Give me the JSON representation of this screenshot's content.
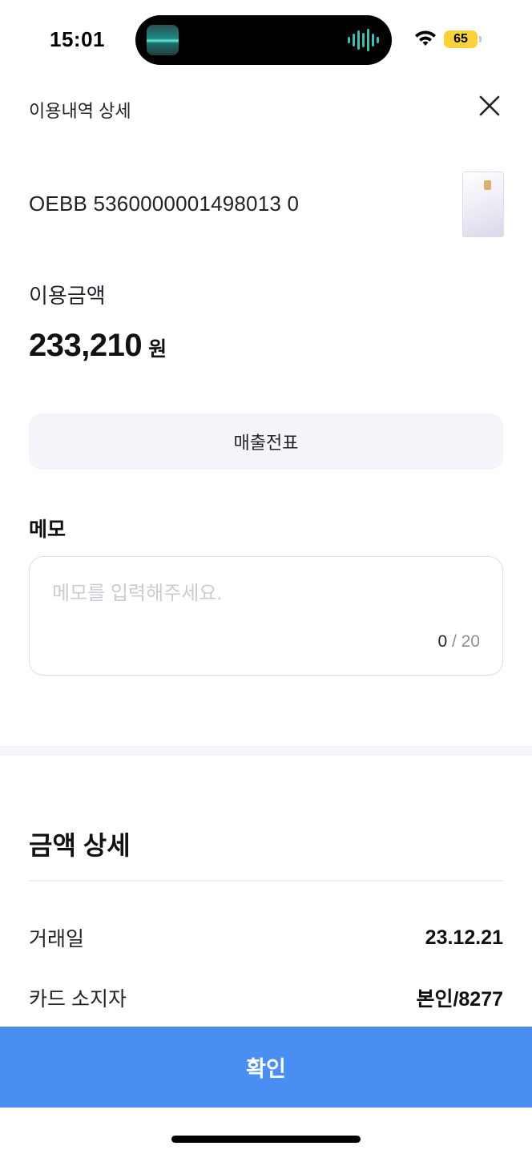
{
  "status_bar": {
    "time": "15:01",
    "battery": "65",
    "wifi_icon": "wifi-icon"
  },
  "header": {
    "title": "이용내역 상세",
    "close_icon": "close-icon"
  },
  "card": {
    "number": "OEBB 5360000001498013 0",
    "image_icon": "credit-card-image"
  },
  "amount": {
    "label": "이용금액",
    "value": "233,210",
    "unit": "원"
  },
  "receipt_button": {
    "label": "매출전표"
  },
  "memo": {
    "label": "메모",
    "placeholder": "메모를 입력해주세요.",
    "value": "",
    "count": "0",
    "max": "/ 20"
  },
  "detail": {
    "title": "금액 상세",
    "rows": [
      {
        "label": "거래일",
        "value": "23.12.21"
      },
      {
        "label": "카드 소지자",
        "value": "본인/8277"
      }
    ]
  },
  "confirm_button": {
    "label": "확인"
  },
  "colors": {
    "primary": "#4a8ef2",
    "battery": "#f9d13a",
    "receipt_bg": "#f3f5fa"
  }
}
